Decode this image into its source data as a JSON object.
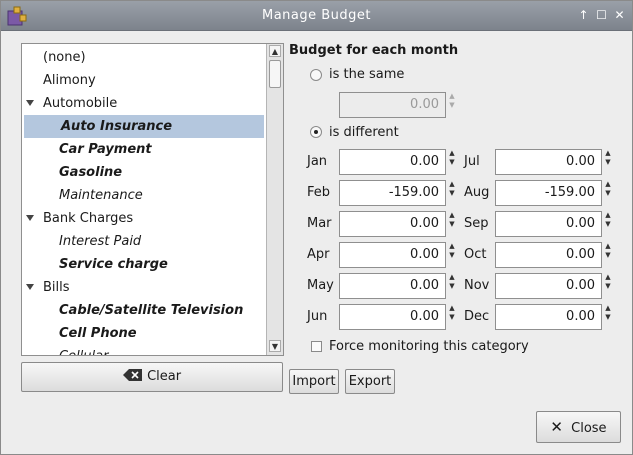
{
  "window": {
    "title": "Manage Budget"
  },
  "categories": [
    {
      "label": "(none)",
      "level": 0,
      "bold": false,
      "expander": false,
      "selected": false
    },
    {
      "label": "Alimony",
      "level": 0,
      "bold": false,
      "expander": false,
      "selected": false
    },
    {
      "label": "Automobile",
      "level": 0,
      "bold": false,
      "expander": true,
      "selected": false
    },
    {
      "label": "Auto Insurance",
      "level": 1,
      "bold": true,
      "expander": false,
      "selected": true
    },
    {
      "label": "Car Payment",
      "level": 1,
      "bold": true,
      "expander": false,
      "selected": false
    },
    {
      "label": "Gasoline",
      "level": 1,
      "bold": true,
      "expander": false,
      "selected": false
    },
    {
      "label": "Maintenance",
      "level": 1,
      "bold": false,
      "expander": false,
      "selected": false
    },
    {
      "label": "Bank Charges",
      "level": 0,
      "bold": false,
      "expander": true,
      "selected": false
    },
    {
      "label": "Interest Paid",
      "level": 1,
      "bold": false,
      "expander": false,
      "selected": false
    },
    {
      "label": "Service charge",
      "level": 1,
      "bold": true,
      "expander": false,
      "selected": false
    },
    {
      "label": "Bills",
      "level": 0,
      "bold": false,
      "expander": true,
      "selected": false
    },
    {
      "label": "Cable/Satellite Television",
      "level": 1,
      "bold": true,
      "expander": false,
      "selected": false
    },
    {
      "label": "Cell Phone",
      "level": 1,
      "bold": true,
      "expander": false,
      "selected": false
    },
    {
      "label": "Cellular",
      "level": 1,
      "bold": false,
      "expander": false,
      "selected": false
    }
  ],
  "buttons": {
    "clear": "Clear",
    "import": "Import",
    "export": "Export",
    "close": "Close"
  },
  "budget": {
    "section_title": "Budget for each month",
    "same_label": "is the same",
    "same_value": "0.00",
    "different_label": "is different",
    "mode": "different",
    "months": [
      {
        "label": "Jan",
        "value": "0.00"
      },
      {
        "label": "Feb",
        "value": "-159.00"
      },
      {
        "label": "Mar",
        "value": "0.00"
      },
      {
        "label": "Apr",
        "value": "0.00"
      },
      {
        "label": "May",
        "value": "0.00"
      },
      {
        "label": "Jun",
        "value": "0.00"
      },
      {
        "label": "Jul",
        "value": "0.00"
      },
      {
        "label": "Aug",
        "value": "-159.00"
      },
      {
        "label": "Sep",
        "value": "0.00"
      },
      {
        "label": "Oct",
        "value": "0.00"
      },
      {
        "label": "Nov",
        "value": "0.00"
      },
      {
        "label": "Dec",
        "value": "0.00"
      }
    ],
    "force_monitoring_label": "Force monitoring this category",
    "force_monitoring_checked": false
  }
}
